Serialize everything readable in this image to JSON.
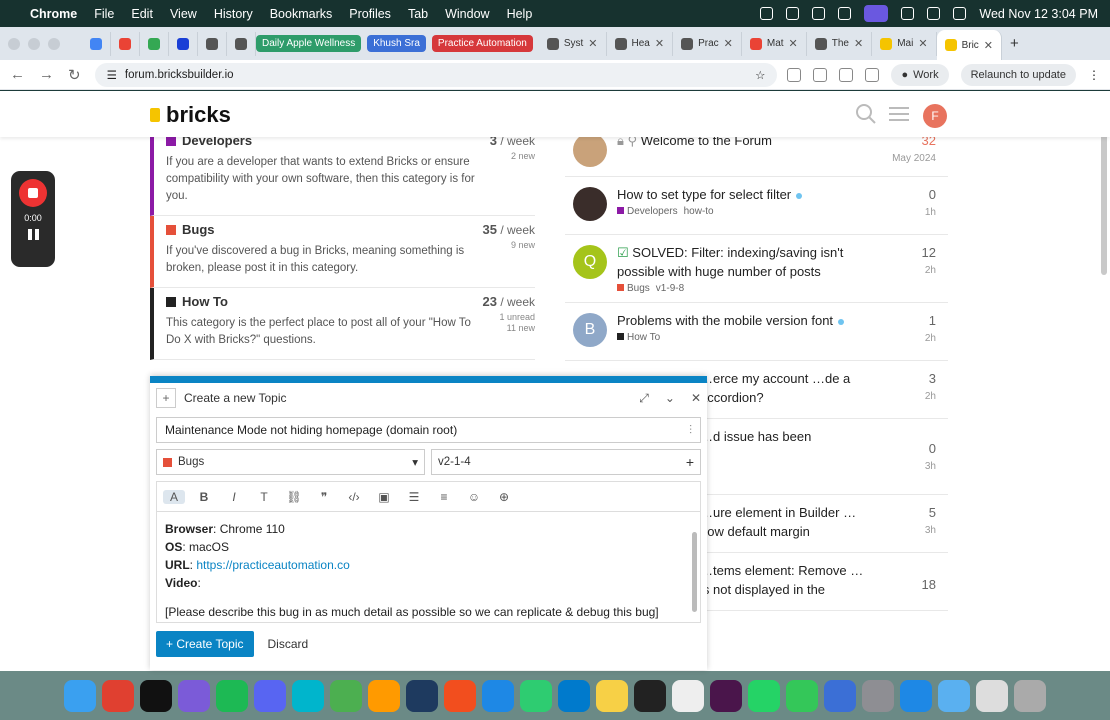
{
  "menubar": {
    "app": "Chrome",
    "items": [
      "File",
      "Edit",
      "View",
      "History",
      "Bookmarks",
      "Profiles",
      "Tab",
      "Window",
      "Help"
    ],
    "datetime": "Wed Nov 12  3:04 PM"
  },
  "tabs": {
    "chips": [
      {
        "label": "Daily Apple Wellness",
        "color": "#2e9c6a"
      },
      {
        "label": "Khush Sra",
        "color": "#3b6fd6"
      },
      {
        "label": "Practice Automation",
        "color": "#d6383b"
      }
    ],
    "items": [
      {
        "label": "Syst"
      },
      {
        "label": "Hea"
      },
      {
        "label": "Prac"
      },
      {
        "label": "Mat"
      },
      {
        "label": "The"
      },
      {
        "label": "Mai"
      },
      {
        "label": "Bric"
      }
    ]
  },
  "address": {
    "url": "forum.bricksbuilder.io",
    "profile": "Work",
    "relaunch": "Relaunch to update"
  },
  "site": {
    "logo": "bricks",
    "avatar": "F"
  },
  "recorder": {
    "time": "0:00"
  },
  "categories": [
    {
      "name": "Developers",
      "color": "#8c1aa6",
      "desc": "If you are a developer that wants to extend Bricks or ensure compatibility with your own software, then this category is for you.",
      "count": "3",
      "per": "/ week",
      "new": "2 new"
    },
    {
      "name": "Bugs",
      "color": "#e5503a",
      "desc": "If you've discovered a bug in Bricks, meaning something is broken, please post it in this category.",
      "count": "35",
      "per": "/ week",
      "new": "9 new"
    },
    {
      "name": "How To",
      "color": "#222222",
      "desc": "This category is the perfect place to post all of your \"How To Do X with Bricks?\" questions.",
      "count": "23",
      "per": "/ week",
      "new": "1 unread\n11 new"
    }
  ],
  "topics": [
    {
      "title": "Welcome to the Forum",
      "count": "32",
      "ago": "May 2024",
      "avatar": "",
      "avcolor": "#c9a27a",
      "tag": "",
      "tagcolor": "",
      "tag2": ""
    },
    {
      "title": "How to set type for select filter",
      "count": "0",
      "ago": "1h",
      "avatar": "",
      "avcolor": "#3a2d2a",
      "tag": "Developers",
      "tagcolor": "#8c1aa6",
      "tag2": "how-to"
    },
    {
      "title": "SOLVED: Filter: indexing/saving isn't possible with huge number of posts",
      "count": "12",
      "ago": "2h",
      "avatar": "Q",
      "avcolor": "#a5c41a",
      "tag": "Bugs",
      "tagcolor": "#e5503a",
      "tag2": "v1-9-8"
    },
    {
      "title": "Problems with the mobile version font",
      "count": "1",
      "ago": "2h",
      "avatar": "B",
      "avcolor": "#8fa8c8",
      "tag": "How To",
      "tagcolor": "#222222",
      "tag2": ""
    },
    {
      "title": "…erce my account …de a accordion?",
      "count": "3",
      "ago": "2h",
      "avatar": "",
      "avcolor": "#ffffff",
      "tag": "",
      "tagcolor": "",
      "tag2": ""
    },
    {
      "title": "…d issue has been",
      "count": "0",
      "ago": "3h",
      "avatar": "",
      "avcolor": "#ffffff",
      "tag": "",
      "tagcolor": "",
      "tag2": ""
    },
    {
      "title": "…ure element in Builder …how default margin",
      "count": "5",
      "ago": "3h",
      "avatar": "",
      "avcolor": "#ffffff",
      "tag": "",
      "tagcolor": "",
      "tag2": ""
    },
    {
      "title": "…tems element: Remove …is not displayed in the",
      "count": "18",
      "ago": "",
      "avatar": "",
      "avcolor": "#ffffff",
      "tag": "",
      "tagcolor": "",
      "tag2": ""
    }
  ],
  "composer": {
    "header": "Create a new Topic",
    "title_value": "Maintenance Mode not hiding homepage (domain root)",
    "category": "Bugs",
    "category_color": "#e5503a",
    "tag": "v2-1-4",
    "body": {
      "browser_label": "Browser",
      "browser": ": Chrome 110",
      "os_label": "OS",
      "os": ": macOS",
      "url_label": "URL",
      "url": "https://practiceautomation.co",
      "video_label": "Video",
      "video": ":",
      "prompt": "[Please describe this bug in as much detail as possible so we can replicate & debug this bug]"
    },
    "create_label": "+ Create Topic",
    "discard_label": "Discard"
  },
  "dock": [
    {
      "n": "finder",
      "c": "#3aa0f0"
    },
    {
      "n": "chrome",
      "c": "#e04030"
    },
    {
      "n": "chatgpt",
      "c": "#111"
    },
    {
      "n": "launchpad",
      "c": "#7b5bd8"
    },
    {
      "n": "spotify",
      "c": "#1db954"
    },
    {
      "n": "discord",
      "c": "#5865f2"
    },
    {
      "n": "canva",
      "c": "#00b5cc"
    },
    {
      "n": "app",
      "c": "#4caf50"
    },
    {
      "n": "illustrator",
      "c": "#ff9a00"
    },
    {
      "n": "photoshop",
      "c": "#1e3a5f"
    },
    {
      "n": "figma",
      "c": "#f24e1e"
    },
    {
      "n": "app2",
      "c": "#1e88e5"
    },
    {
      "n": "app3",
      "c": "#2ecc71"
    },
    {
      "n": "vscode",
      "c": "#007acc"
    },
    {
      "n": "notes",
      "c": "#f7d046"
    },
    {
      "n": "notion",
      "c": "#222"
    },
    {
      "n": "calendar",
      "c": "#eee"
    },
    {
      "n": "slack",
      "c": "#4a154b"
    },
    {
      "n": "whatsapp",
      "c": "#25d366"
    },
    {
      "n": "messages",
      "c": "#34c759"
    },
    {
      "n": "app4",
      "c": "#3b6fd6"
    },
    {
      "n": "settings",
      "c": "#8e8e93"
    },
    {
      "n": "safari",
      "c": "#1e88e5"
    },
    {
      "n": "folder",
      "c": "#5ab0f0"
    },
    {
      "n": "window",
      "c": "#ddd"
    },
    {
      "n": "trash",
      "c": "#aaa"
    }
  ]
}
